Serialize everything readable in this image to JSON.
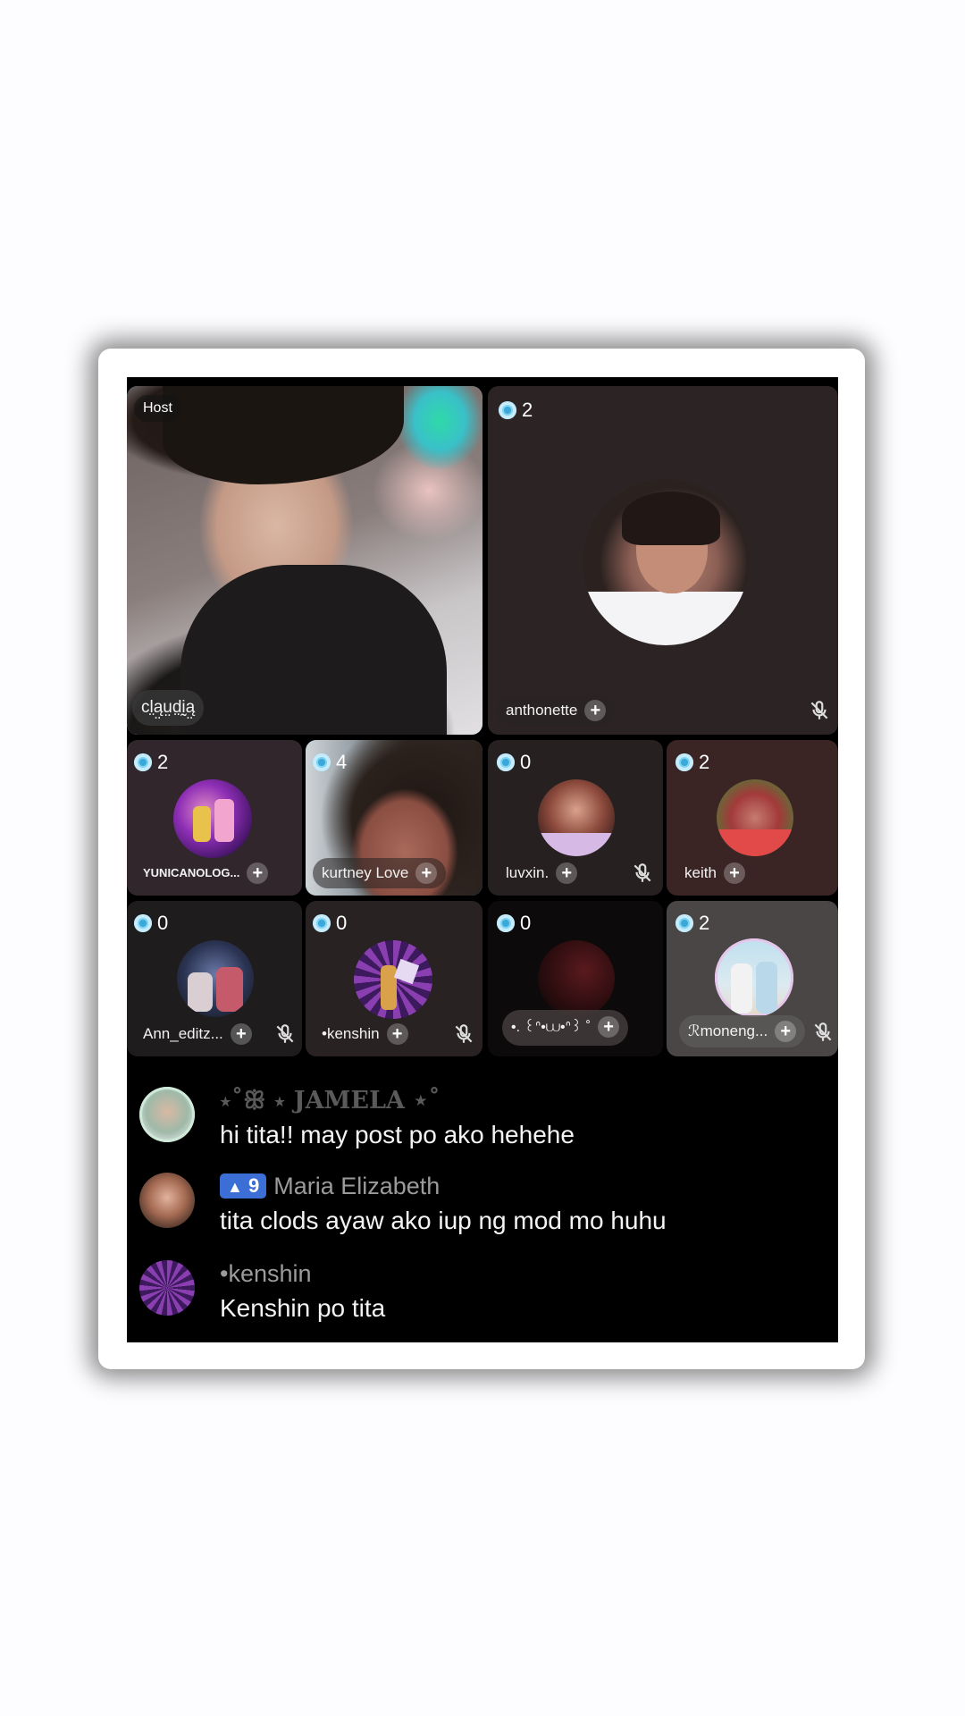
{
  "room": {
    "host_tag": "Host",
    "host_name": "cl̤ą̤ṳd̤ḭą̤",
    "participants": [
      {
        "name": "anthonette",
        "coins": "2"
      },
      {
        "name": "YUNICANOLOG...",
        "coins": "2"
      },
      {
        "name": "kurtney Love",
        "coins": "4"
      },
      {
        "name": "luvxin.",
        "coins": "0"
      },
      {
        "name": "keith",
        "coins": "2"
      },
      {
        "name": "Ann_editz...",
        "coins": "0"
      },
      {
        "name": "•kenshin",
        "coins": "0"
      },
      {
        "name": "•. ꒰ᐢ•⩊•ᐢ꒱ ˚",
        "coins": "0"
      },
      {
        "name": "ℛmoneng...",
        "coins": "2"
      }
    ],
    "add_symbol": "+"
  },
  "chat": {
    "messages": [
      {
        "name": "⋆˚ꕥ ⋆ JAMELA ⋆˚",
        "level": "",
        "text": "hi tita!! may post po ako hehehe"
      },
      {
        "name": "Maria Elizabeth",
        "level": "9",
        "text": "tita clods ayaw ako iup ng mod mo huhu"
      },
      {
        "name": "•kenshin",
        "level": "",
        "text": "Kenshin po tita"
      }
    ]
  },
  "colors": {
    "active_border": "#3ab5d8",
    "coin": "#7fd3f3",
    "level_badge": "#3b6fd6"
  },
  "icons": [
    "coin-icon",
    "plus-icon",
    "mic-muted-icon",
    "level-triangle-icon"
  ]
}
